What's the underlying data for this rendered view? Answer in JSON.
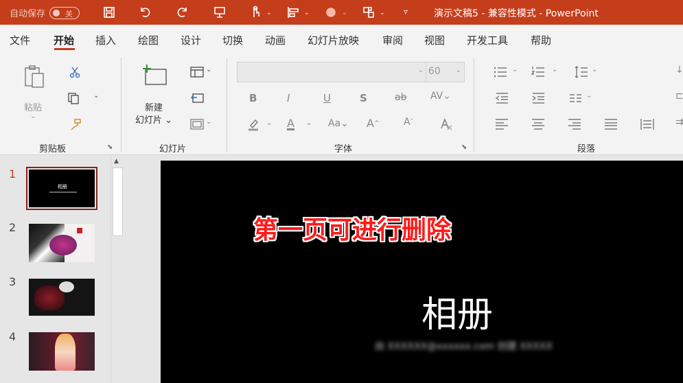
{
  "titlebar": {
    "autosave_label": "自动保存",
    "autosave_state": "关",
    "doc_title": "演示文稿5  -  兼容性模式  -  PowerPoint"
  },
  "tabs": [
    "文件",
    "开始",
    "插入",
    "绘图",
    "设计",
    "切换",
    "动画",
    "幻灯片放映",
    "审阅",
    "视图",
    "开发工具",
    "帮助"
  ],
  "active_tab": "开始",
  "ribbon": {
    "clipboard": {
      "label": "剪贴板",
      "paste": "粘贴"
    },
    "slides": {
      "label": "幻灯片",
      "new_slide_1": "新建",
      "new_slide_2": "幻灯片"
    },
    "font": {
      "label": "字体",
      "font_name": "",
      "font_size": "60"
    },
    "paragraph": {
      "label": "段落"
    }
  },
  "slides": [
    {
      "num": "1",
      "thumb_title": "相册"
    },
    {
      "num": "2"
    },
    {
      "num": "3"
    },
    {
      "num": "4"
    }
  ],
  "canvas": {
    "annotation": "第一页可进行删除",
    "title": "相册",
    "subtitle": "由 XXXXXX@xxxxxx.com 创建 XXXXX"
  },
  "colors": {
    "accent": "#c43e1c",
    "annotation": "#ff1a1a"
  }
}
